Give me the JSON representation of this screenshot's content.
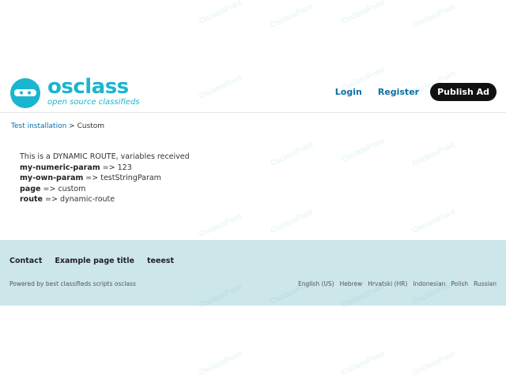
{
  "header": {
    "logo_word": "osclass",
    "logo_tagline": "open source classifieds",
    "nav": {
      "login": "Login",
      "register": "Register",
      "publish": "Publish Ad"
    }
  },
  "breadcrumb": {
    "home": "Test installation",
    "separator": ">",
    "current": "Custom"
  },
  "content": {
    "intro": "This is a DYNAMIC ROUTE, variables received",
    "params": [
      {
        "key": "my-numeric-param",
        "arrow": "=>",
        "value": "123"
      },
      {
        "key": "my-own-param",
        "arrow": "=>",
        "value": "testStringParam"
      },
      {
        "key": "page",
        "arrow": "=>",
        "value": "custom"
      },
      {
        "key": "route",
        "arrow": "=>",
        "value": "dynamic-route"
      }
    ]
  },
  "footer": {
    "links": [
      "Contact",
      "Example page title",
      "teeest"
    ],
    "powered_prefix": "Powered by",
    "powered_link": "best classifieds scripts osclass",
    "languages": [
      "English (US)",
      "Hebrew",
      "Hrvatski (HR)",
      "Indonesian",
      "Polish",
      "Russian"
    ]
  },
  "watermark_text": "OsclassPoint",
  "colors": {
    "brand": "#1ab5d0",
    "link": "#0a6fa8",
    "footer_bg": "#cde6ea",
    "button_bg": "#111111"
  }
}
